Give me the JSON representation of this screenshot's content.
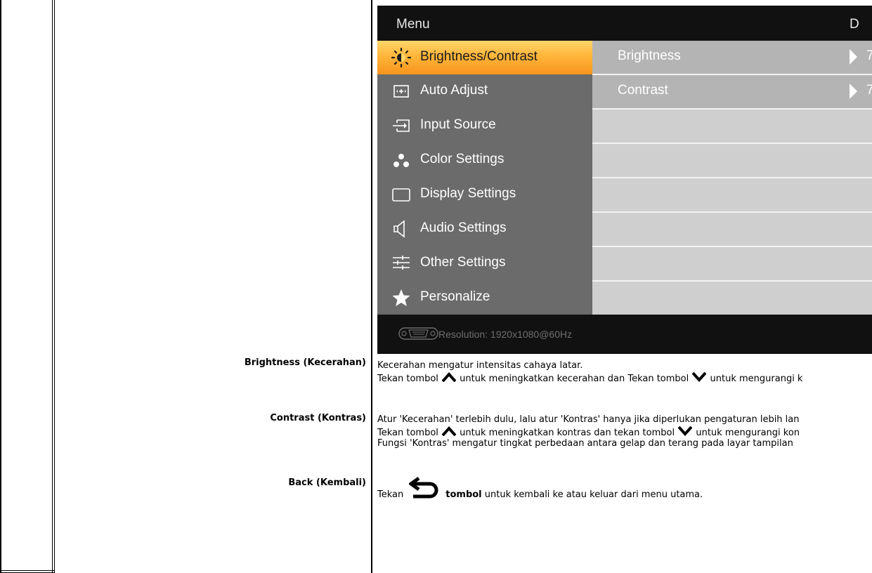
{
  "osd": {
    "title": "Menu",
    "corner_text": "D",
    "menu_items": [
      {
        "label": "Brightness/Contrast",
        "icon": "brightness-icon",
        "active": true
      },
      {
        "label": "Auto Adjust",
        "icon": "auto-adjust-icon"
      },
      {
        "label": "Input Source",
        "icon": "input-source-icon"
      },
      {
        "label": "Color Settings",
        "icon": "color-settings-icon"
      },
      {
        "label": "Display Settings",
        "icon": "display-settings-icon"
      },
      {
        "label": "Audio Settings",
        "icon": "audio-settings-icon"
      },
      {
        "label": "Other Settings",
        "icon": "other-settings-icon"
      },
      {
        "label": "Personalize",
        "icon": "star-icon"
      }
    ],
    "submenu": [
      {
        "label": "Brightness",
        "value": "7"
      },
      {
        "label": "Contrast",
        "value": "7"
      }
    ],
    "footer_resolution": "Resolution:  1920x1080@60Hz",
    "colors": {
      "active_highlight": "#ffb53a",
      "menu_bg": "#6b6b6b",
      "submenu_bg": "#b4b4b4"
    }
  },
  "sections": {
    "brightness": {
      "label": "Brightness (Kecerahan)",
      "line1": "Kecerahan mengatur intensitas cahaya latar.",
      "line2_a": "Tekan tombol ",
      "line2_b": " untuk meningkatkan kecerahan dan Tekan tombol ",
      "line2_c": " untuk mengurangi k"
    },
    "contrast": {
      "label": "Contrast (Kontras)",
      "line1": "Atur 'Kecerahan' terlebih dulu, lalu atur 'Kontras' hanya jika diperlukan pengaturan lebih lan",
      "line2_a": "Tekan tombol ",
      "line2_b": " untuk meningkatkan kontras dan tekan tombol ",
      "line2_c": " untuk mengurangi kon",
      "line3": "Fungsi 'Kontras' mengatur tingkat perbedaan antara gelap dan terang pada layar tampilan"
    },
    "back": {
      "label": "Back (Kembali)",
      "text_a": "Tekan",
      "text_bold": "tombol",
      "text_b": " untuk kembali ke atau keluar dari menu utama."
    }
  }
}
